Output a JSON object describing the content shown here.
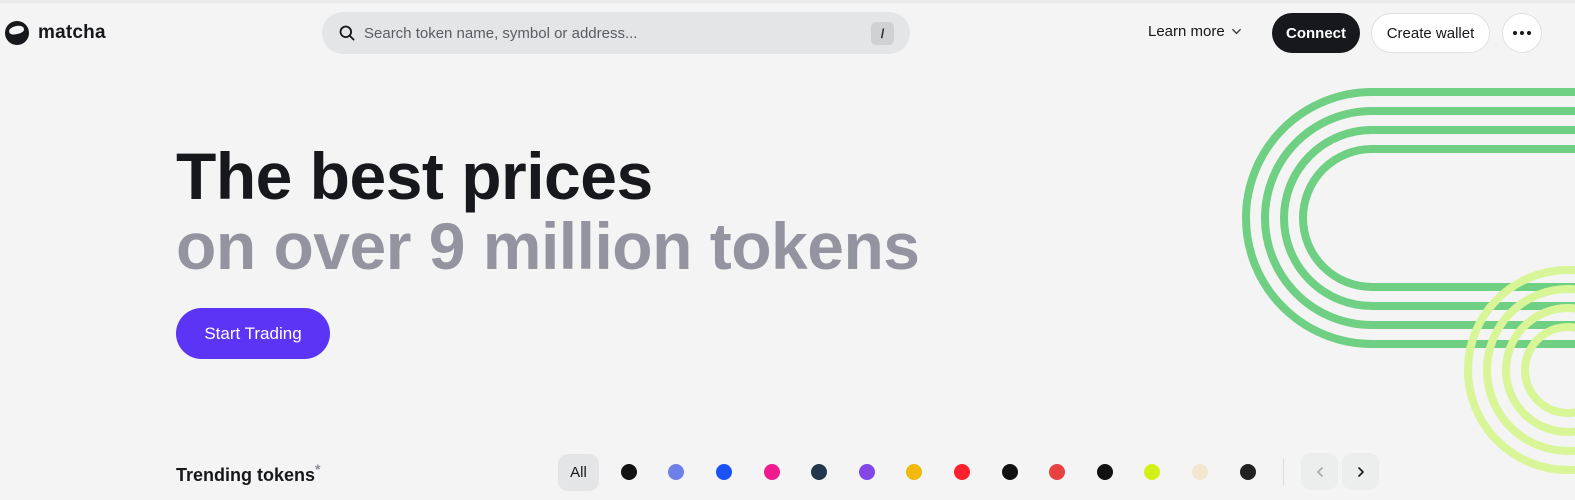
{
  "brand": {
    "name": "matcha"
  },
  "search": {
    "placeholder": "Search token name, symbol or address...",
    "shortcut": "/"
  },
  "nav": {
    "learn_more": "Learn more",
    "connect": "Connect",
    "create_wallet": "Create wallet"
  },
  "hero": {
    "line1": "The best prices",
    "line2": "on over 9 million tokens",
    "cta": "Start Trading"
  },
  "trending": {
    "title": "Trending tokens",
    "asterisk": "*",
    "all_label": "All",
    "chains": [
      {
        "icon": "solana-icon",
        "color": "#111111"
      },
      {
        "icon": "ethereum-icon",
        "color": "#6f7fe8"
      },
      {
        "icon": "base-icon",
        "color": "#1a52f5"
      },
      {
        "icon": "optimism-sparkle-icon",
        "color": "#f01a8e"
      },
      {
        "icon": "arbitrum-icon",
        "color": "#23374d"
      },
      {
        "icon": "polygon-icon",
        "color": "#8247e5"
      },
      {
        "icon": "bnb-icon",
        "color": "#f0b90b"
      },
      {
        "icon": "optimism-icon",
        "color": "#ff1f2d"
      },
      {
        "icon": "linea-icon",
        "color": "#111111"
      },
      {
        "icon": "avalanche-icon",
        "color": "#e84142"
      },
      {
        "icon": "blast-icon",
        "color": "#111111"
      },
      {
        "icon": "mantle-icon",
        "color": "#d4f01a"
      },
      {
        "icon": "scroll-icon",
        "color": "#f2e6d0"
      },
      {
        "icon": "unichain-icon",
        "color": "#222222"
      }
    ]
  },
  "colors": {
    "accent": "#5b34f5",
    "dark": "#17181b",
    "muted_heading": "#9394a0",
    "deco_green": "#6fcf82",
    "deco_lime": "#d8f598"
  }
}
